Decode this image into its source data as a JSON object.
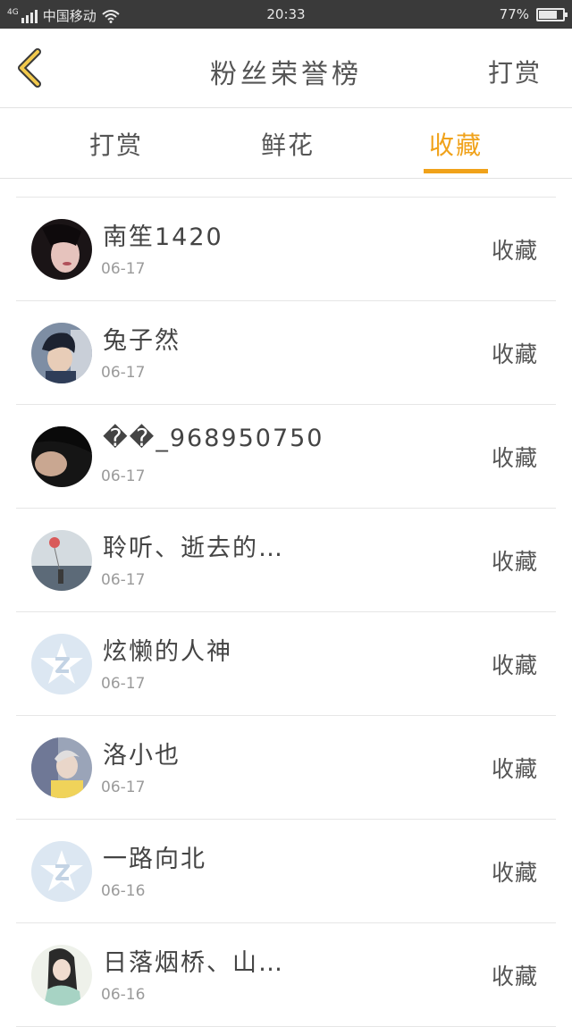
{
  "status_bar": {
    "network": "4G",
    "carrier": "中国移动",
    "time": "20:33",
    "battery_text": "77%",
    "battery_level": 0.77
  },
  "nav": {
    "title": "粉丝荣誉榜",
    "action": "打赏",
    "back_icon": "chevron-left-icon",
    "accent_color": "#f0a21a"
  },
  "tabs": [
    {
      "label": "打赏",
      "active": false
    },
    {
      "label": "鲜花",
      "active": false
    },
    {
      "label": "收藏",
      "active": true
    }
  ],
  "fans": [
    {
      "name": "南笙1420",
      "date": "06-17",
      "action": "收藏",
      "avatar": "photo-avatar"
    },
    {
      "name": "兔子然",
      "date": "06-17",
      "action": "收藏",
      "avatar": "photo-avatar"
    },
    {
      "name": "��_968950750",
      "date": "06-17",
      "action": "收藏",
      "avatar": "photo-avatar"
    },
    {
      "name": "聆听、逝去的…",
      "date": "06-17",
      "action": "收藏",
      "avatar": "photo-avatar"
    },
    {
      "name": "炫懒的人神",
      "date": "06-17",
      "action": "收藏",
      "avatar": "default-star-avatar"
    },
    {
      "name": "洛小也",
      "date": "06-17",
      "action": "收藏",
      "avatar": "photo-avatar"
    },
    {
      "name": "一路向北",
      "date": "06-16",
      "action": "收藏",
      "avatar": "default-star-avatar"
    },
    {
      "name": "日落烟桥、山…",
      "date": "06-16",
      "action": "收藏",
      "avatar": "photo-avatar"
    }
  ]
}
